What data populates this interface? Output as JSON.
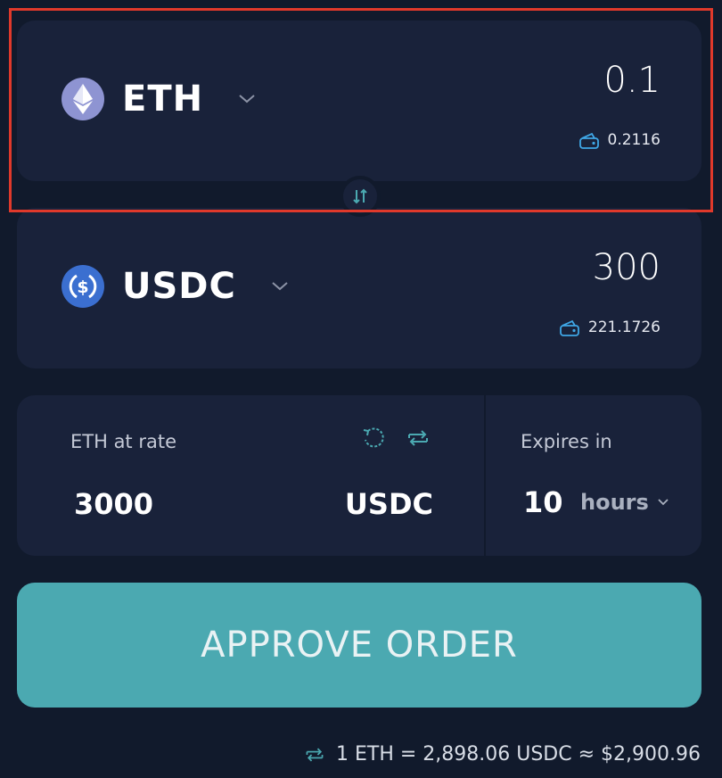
{
  "sell": {
    "token": "ETH",
    "token_icon": "ethereum-icon",
    "amount": "0.1",
    "balance": "0.2116"
  },
  "buy": {
    "token": "USDC",
    "token_icon": "usdc-icon",
    "amount": "300",
    "balance": "221.1726"
  },
  "rate": {
    "label": "ETH at rate",
    "value": "3000",
    "unit": "USDC"
  },
  "expires": {
    "label": "Expires in",
    "value": "10",
    "unit": "hours"
  },
  "approve_label": "APPROVE ORDER",
  "footer": {
    "rate_text": "1 ETH = 2,898.06 USDC ≈ $2,900.96"
  },
  "colors": {
    "background": "#111a2c",
    "card": "#19223a",
    "accent": "#4ba9b1",
    "highlight": "#e0392b",
    "wallet_icon": "#3fa7e6"
  }
}
